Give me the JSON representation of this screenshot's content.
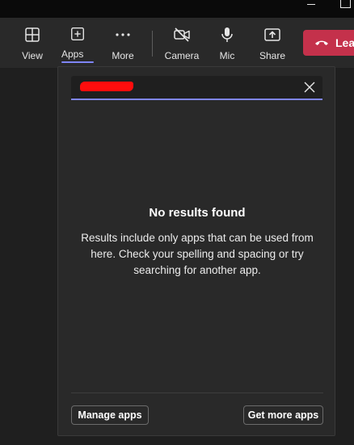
{
  "toolbar": {
    "view_label": "View",
    "apps_label": "Apps",
    "more_label": "More",
    "camera_label": "Camera",
    "mic_label": "Mic",
    "share_label": "Share",
    "leave_label": "Leave"
  },
  "panel": {
    "search": {
      "value": "",
      "placeholder": ""
    },
    "empty_title": "No results found",
    "empty_body": "Results include only apps that can be used from here. Check your spelling and spacing or try searching for another app.",
    "manage_apps_label": "Manage apps",
    "get_more_apps_label": "Get more apps"
  },
  "colors": {
    "accent": "#7f85f5",
    "leave": "#c4314b",
    "redaction": "#ff0d0d"
  },
  "icons": [
    "minimize-icon",
    "maximize-icon",
    "grid-icon",
    "add-square-icon",
    "more-dots-icon",
    "camera-off-icon",
    "mic-icon",
    "share-icon",
    "phone-hangup-icon",
    "close-icon"
  ]
}
